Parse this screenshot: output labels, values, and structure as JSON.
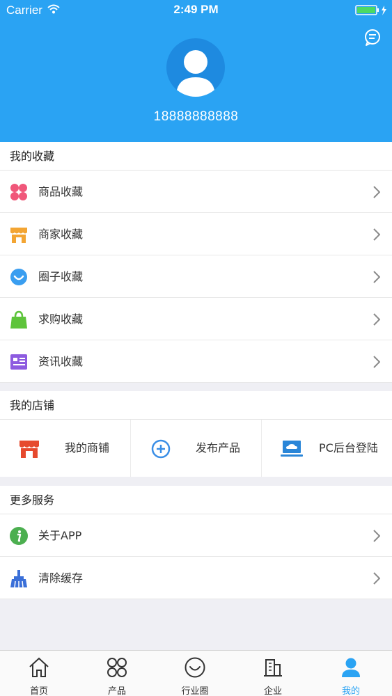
{
  "status": {
    "carrier": "Carrier",
    "time": "2:49 PM"
  },
  "profile": {
    "phone": "18888888888"
  },
  "favorites": {
    "title": "我的收藏",
    "items": [
      {
        "label": "商品收藏",
        "icon": "clover-icon",
        "color": "#f0577a"
      },
      {
        "label": "商家收藏",
        "icon": "storefront-icon",
        "color": "#f3a533"
      },
      {
        "label": "圈子收藏",
        "icon": "smile-circle-icon",
        "color": "#3a9ef0"
      },
      {
        "label": "求购收藏",
        "icon": "shopping-bag-icon",
        "color": "#5ec43b"
      },
      {
        "label": "资讯收藏",
        "icon": "news-icon",
        "color": "#8d5be0"
      }
    ]
  },
  "shop": {
    "title": "我的店铺",
    "items": [
      {
        "label": "我的商铺",
        "icon": "shop-icon",
        "color": "#e64a2e"
      },
      {
        "label": "发布产品",
        "icon": "plus-circle-icon",
        "color": "#3a8ee6"
      },
      {
        "label": "PC后台登陆",
        "icon": "laptop-cloud-icon",
        "color": "#2a86d8"
      }
    ]
  },
  "more": {
    "title": "更多服务",
    "items": [
      {
        "label": "关于APP",
        "icon": "info-icon",
        "color": "#4caf50"
      },
      {
        "label": "清除缓存",
        "icon": "broom-icon",
        "color": "#3a6fd8"
      }
    ]
  },
  "tabs": [
    {
      "label": "首页",
      "icon": "home-icon"
    },
    {
      "label": "产品",
      "icon": "grid-icon"
    },
    {
      "label": "行业圈",
      "icon": "smile-icon"
    },
    {
      "label": "企业",
      "icon": "building-icon"
    },
    {
      "label": "我的",
      "icon": "person-icon",
      "active": true
    }
  ],
  "colors": {
    "accent": "#2aa3f3",
    "background": "#efeff4"
  }
}
